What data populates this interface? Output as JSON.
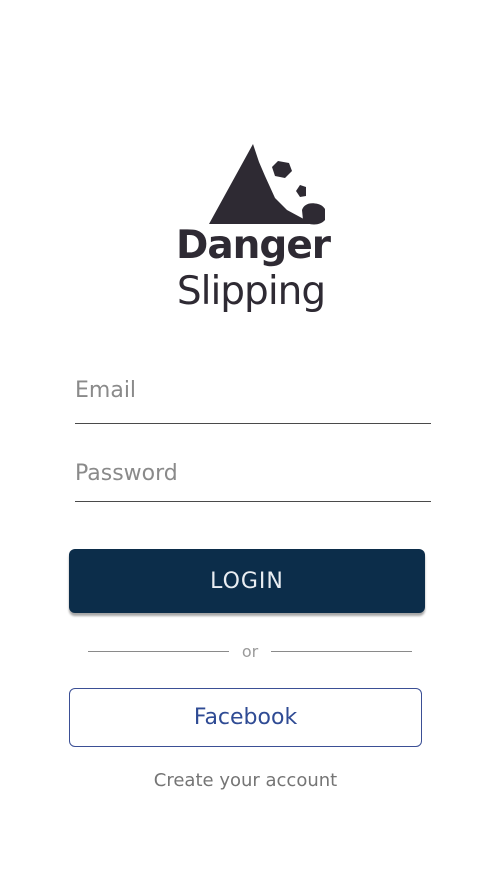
{
  "logo": {
    "line1": "Danger",
    "line2": "Slipping",
    "icon": "falling-rocks-mountain-icon",
    "color": "#2e2a33"
  },
  "form": {
    "email_placeholder": "Email",
    "password_placeholder": "Password",
    "login_label": "LOGIN",
    "divider_text": "or",
    "facebook_label": "Facebook",
    "create_account_label": "Create your account"
  },
  "colors": {
    "login_bg": "#0c2d4a",
    "login_text": "#e9edf2",
    "facebook_border": "#3b4f95",
    "facebook_text": "#2f4b94"
  }
}
